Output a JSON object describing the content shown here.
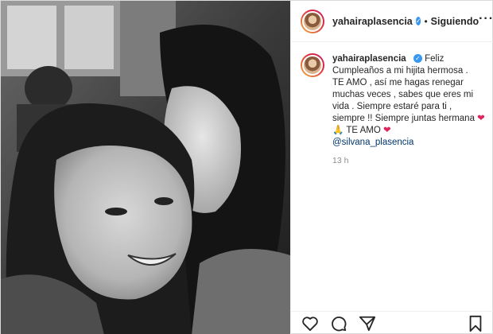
{
  "post": {
    "username": "yahairaplasencia",
    "verified": true,
    "separator": "•",
    "follow_state": "Siguiendo",
    "more_label": "···",
    "caption": {
      "username": "yahairaplasencia",
      "lines": [
        "Feliz Cumpleaños a mi hijita hermosa .",
        "TE AMO , así me hagas renegar muchas veces , sabes que eres mi vida . Siempre estaré para ti , siempre !! Siempre juntas hermana",
        "TE AMO"
      ],
      "emoji_1": "❤",
      "emoji_2": "🙏",
      "emoji_3": "❤",
      "mention": "@silvana_plasencia"
    },
    "timestamp": "13 h"
  },
  "icons": {
    "verified": "verified-badge-icon",
    "like": "heart-outline-icon",
    "comment": "comment-bubble-icon",
    "share": "paper-plane-icon",
    "save": "bookmark-icon"
  },
  "colors": {
    "verified": "#3897f0",
    "mention": "#003569",
    "timestamp": "#8e8e8e",
    "heart": "#e0245e"
  }
}
